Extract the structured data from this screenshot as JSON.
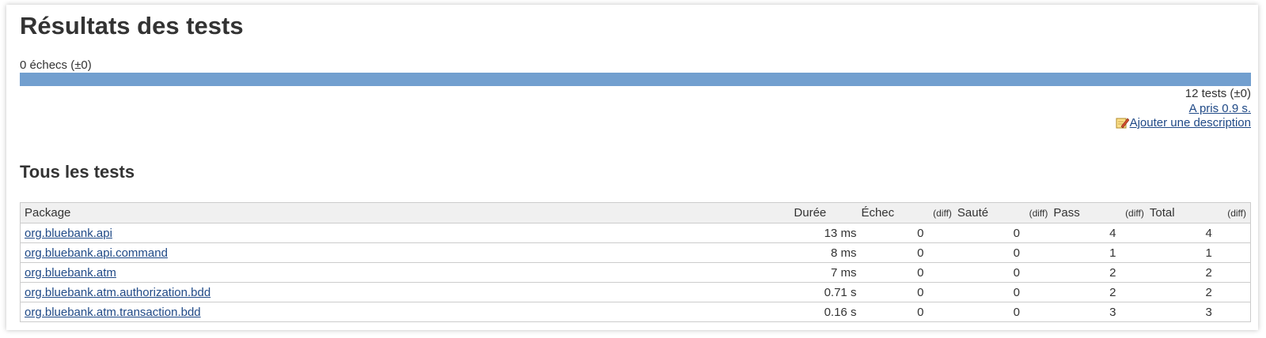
{
  "title": "Résultats des tests",
  "failures_summary": "0 échecs (±0)",
  "progress": {
    "pass_fraction": 1.0,
    "color": "#729fcf"
  },
  "summary": {
    "tests_count": "12 tests (±0)",
    "duration_link": "A pris 0.9 s.",
    "add_description_link": "Ajouter une description"
  },
  "all_tests_heading": "Tous les tests",
  "table": {
    "headers": {
      "package": "Package",
      "duration": "Durée",
      "fail": "Échec",
      "fail_diff": "(diff)",
      "skip": "Sauté",
      "skip_diff": "(diff)",
      "pass": "Pass",
      "pass_diff": "(diff)",
      "total": "Total",
      "total_diff": "(diff)"
    },
    "rows": [
      {
        "package": "org.bluebank.api",
        "duration": "13 ms",
        "fail": "0",
        "fail_diff": "",
        "skip": "0",
        "skip_diff": "",
        "pass": "4",
        "pass_diff": "",
        "total": "4",
        "total_diff": ""
      },
      {
        "package": "org.bluebank.api.command",
        "duration": "8 ms",
        "fail": "0",
        "fail_diff": "",
        "skip": "0",
        "skip_diff": "",
        "pass": "1",
        "pass_diff": "",
        "total": "1",
        "total_diff": ""
      },
      {
        "package": "org.bluebank.atm",
        "duration": "7 ms",
        "fail": "0",
        "fail_diff": "",
        "skip": "0",
        "skip_diff": "",
        "pass": "2",
        "pass_diff": "",
        "total": "2",
        "total_diff": ""
      },
      {
        "package": "org.bluebank.atm.authorization.bdd",
        "duration": "0.71 s",
        "fail": "0",
        "fail_diff": "",
        "skip": "0",
        "skip_diff": "",
        "pass": "2",
        "pass_diff": "",
        "total": "2",
        "total_diff": ""
      },
      {
        "package": "org.bluebank.atm.transaction.bdd",
        "duration": "0.16 s",
        "fail": "0",
        "fail_diff": "",
        "skip": "0",
        "skip_diff": "",
        "pass": "3",
        "pass_diff": "",
        "total": "3",
        "total_diff": ""
      }
    ]
  }
}
